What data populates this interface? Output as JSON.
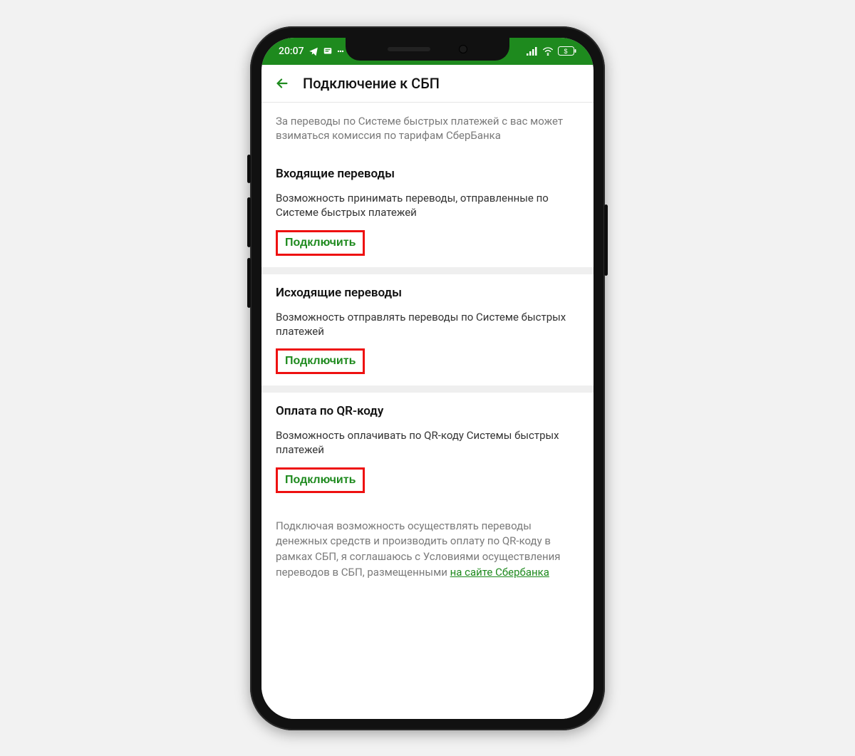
{
  "status": {
    "time": "20:07"
  },
  "header": {
    "title": "Подключение к СБП"
  },
  "intro": "За переводы по Системе быстрых платежей с вас может взиматься комиссия по тарифам СберБанка",
  "sections": [
    {
      "title": "Входящие переводы",
      "desc": "Возможность принимать переводы, отправленные по Системе быстрых платежей",
      "action": "Подключить"
    },
    {
      "title": "Исходящие переводы",
      "desc": "Возможность отправлять переводы по Системе быстрых платежей",
      "action": "Подключить"
    },
    {
      "title": "Оплата по QR-коду",
      "desc": "Возможность оплачивать по QR-коду Системы быстрых платежей",
      "action": "Подключить"
    }
  ],
  "legal": {
    "text": "Подключая возможность осуществлять переводы денежных средств и производить оплату по QR-коду в рамках СБП, я соглашаюсь с Условиями осуществления переводов в СБП, размещенными ",
    "link": "на сайте Сбербанка"
  }
}
